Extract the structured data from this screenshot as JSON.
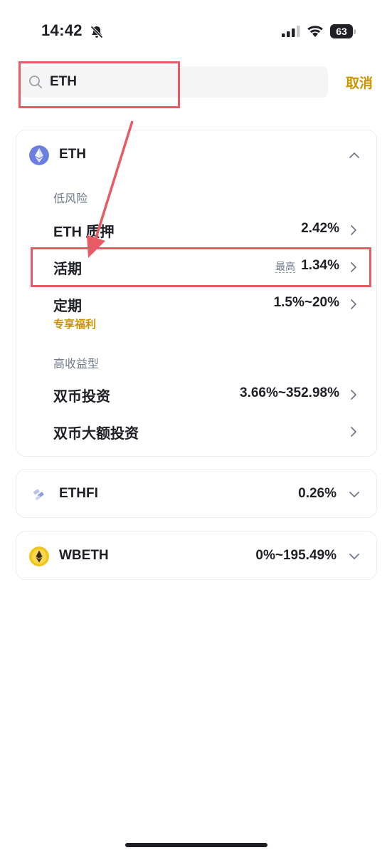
{
  "status_bar": {
    "time": "14:42",
    "battery": "63"
  },
  "search": {
    "value": "ETH",
    "cancel_label": "取消"
  },
  "eth_card": {
    "name": "ETH",
    "sections": {
      "low_risk": "低风险",
      "high_yield": "高收益型"
    },
    "products": {
      "staking": {
        "name": "ETH 质押",
        "rate": "2.42%"
      },
      "flexible": {
        "name": "活期",
        "rate_prefix": "最高",
        "rate": "1.34%"
      },
      "locked": {
        "name": "定期",
        "rate": "1.5%~20%",
        "tag": "专享福利"
      },
      "dual": {
        "name": "双币投资",
        "rate": "3.66%~352.98%"
      },
      "dual_large": {
        "name": "双币大额投资",
        "rate": ""
      }
    }
  },
  "ethfi_card": {
    "name": "ETHFI",
    "rate": "0.26%"
  },
  "wbeth_card": {
    "name": "WBETH",
    "rate": "0%~195.49%"
  },
  "colors": {
    "accent": "#c99400",
    "highlight": "#e85a64",
    "text": "#1e2026",
    "muted": "#707a8a"
  }
}
